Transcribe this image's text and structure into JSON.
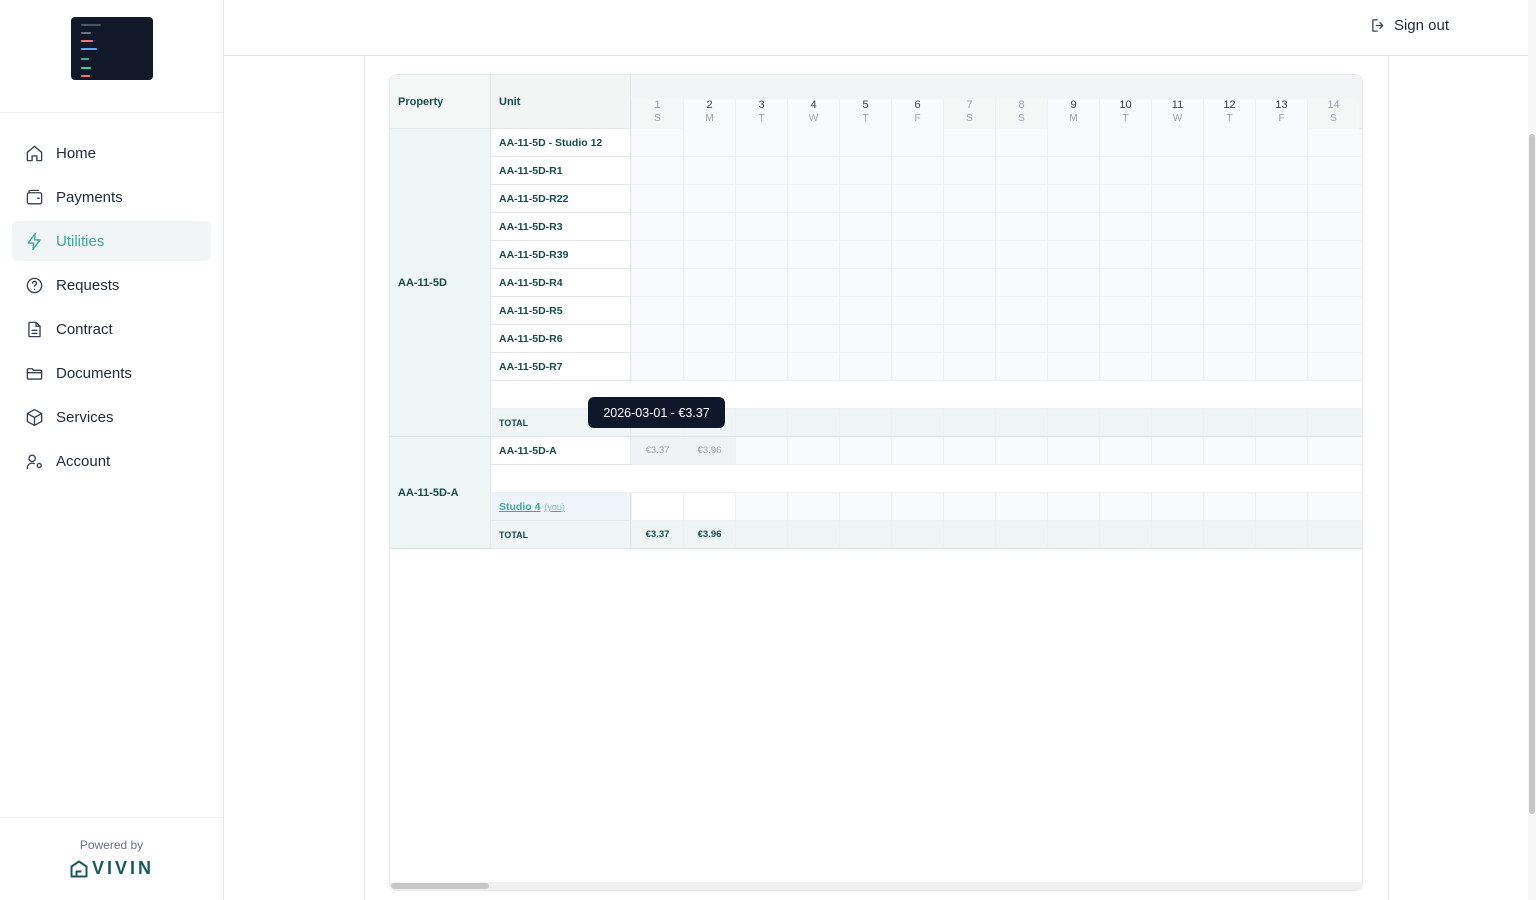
{
  "nav": {
    "items": [
      {
        "label": "Home",
        "icon": "home-icon"
      },
      {
        "label": "Payments",
        "icon": "wallet-icon"
      },
      {
        "label": "Utilities",
        "icon": "bolt-icon",
        "active": true
      },
      {
        "label": "Requests",
        "icon": "help-circle-icon"
      },
      {
        "label": "Contract",
        "icon": "file-text-icon"
      },
      {
        "label": "Documents",
        "icon": "folder-icon"
      },
      {
        "label": "Services",
        "icon": "box-icon"
      },
      {
        "label": "Account",
        "icon": "user-cog-icon"
      }
    ]
  },
  "footer": {
    "powered_by": "Powered by",
    "brand": "VIVIN"
  },
  "topbar": {
    "signout_label": "Sign out"
  },
  "grid": {
    "header": {
      "property": "Property",
      "unit": "Unit"
    },
    "days": [
      {
        "num": "1",
        "dow": "S"
      },
      {
        "num": "2",
        "dow": "M"
      },
      {
        "num": "3",
        "dow": "T"
      },
      {
        "num": "4",
        "dow": "W"
      },
      {
        "num": "5",
        "dow": "T"
      },
      {
        "num": "6",
        "dow": "F"
      },
      {
        "num": "7",
        "dow": "S"
      },
      {
        "num": "8",
        "dow": "S"
      },
      {
        "num": "9",
        "dow": "M"
      },
      {
        "num": "10",
        "dow": "T"
      },
      {
        "num": "11",
        "dow": "W"
      },
      {
        "num": "12",
        "dow": "T"
      },
      {
        "num": "13",
        "dow": "F"
      },
      {
        "num": "14",
        "dow": "S"
      }
    ],
    "groups": [
      {
        "property": "AA-11-5D",
        "units": [
          "AA-11-5D - Studio 12",
          "AA-11-5D-R1",
          "AA-11-5D-R22",
          "AA-11-5D-R3",
          "AA-11-5D-R39",
          "AA-11-5D-R4",
          "AA-11-5D-R5",
          "AA-11-5D-R6",
          "AA-11-5D-R7"
        ],
        "total_label": "TOTAL",
        "totals": []
      },
      {
        "property": "AA-11-5D-A",
        "unit_a": {
          "label": "AA-11-5D-A",
          "values": [
            "€3.37",
            "€3.96"
          ]
        },
        "you_unit": {
          "label": "Studio 4",
          "tag": "(you)"
        },
        "total_label": "TOTAL",
        "totals": [
          "€3.37",
          "€3.96"
        ]
      }
    ]
  },
  "tooltip": {
    "text": "2026-03-01 - €3.37"
  },
  "colors": {
    "accent": "#3aaa9f",
    "dark_teal": "#174b4b",
    "tooltip_bg": "#0f172a"
  }
}
